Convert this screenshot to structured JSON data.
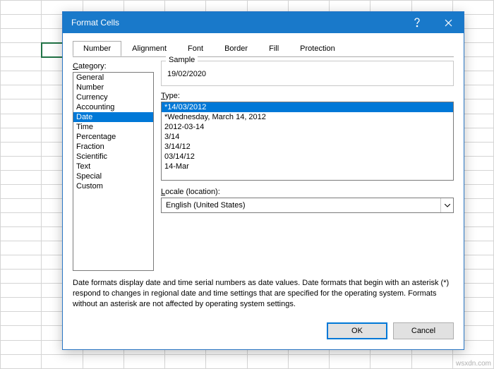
{
  "dialog": {
    "title": "Format Cells",
    "tabs": [
      "Number",
      "Alignment",
      "Font",
      "Border",
      "Fill",
      "Protection"
    ],
    "active_tab": "Number",
    "category_label": "Category:",
    "categories": [
      "General",
      "Number",
      "Currency",
      "Accounting",
      "Date",
      "Time",
      "Percentage",
      "Fraction",
      "Scientific",
      "Text",
      "Special",
      "Custom"
    ],
    "selected_category": "Date",
    "sample_label": "Sample",
    "sample_value": "19/02/2020",
    "type_label": "Type:",
    "types": [
      "*14/03/2012",
      "*Wednesday, March 14, 2012",
      "2012-03-14",
      "3/14",
      "3/14/12",
      "03/14/12",
      "14-Mar"
    ],
    "selected_type": "*14/03/2012",
    "locale_label": "Locale (location):",
    "locale_value": "English (United States)",
    "description": "Date formats display date and time serial numbers as date values. Date formats that begin with an asterisk (*) respond to changes in regional date and time settings that are specified for the operating system. Formats without an asterisk are not affected by operating system settings.",
    "ok_label": "OK",
    "cancel_label": "Cancel"
  },
  "watermark": "wsxdn.com"
}
